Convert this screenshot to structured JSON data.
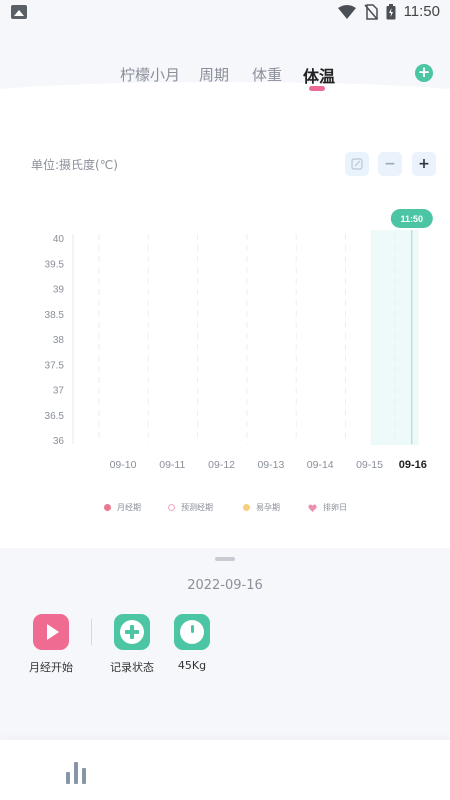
{
  "status_bar": {
    "time": "11:50"
  },
  "tabs": [
    {
      "label": "柠檬小月",
      "active": false
    },
    {
      "label": "周期",
      "active": false
    },
    {
      "label": "体重",
      "active": false
    },
    {
      "label": "体温",
      "active": true
    }
  ],
  "add_button": "+",
  "unit_label": "单位:摄氏度(℃)",
  "controls": {
    "minus": "−",
    "plus": "+"
  },
  "chart_data": {
    "type": "line",
    "title": "",
    "ylabel": "",
    "xlabel": "",
    "ylim": [
      36,
      40
    ],
    "yticks": [
      "40",
      "39.5",
      "39",
      "38.5",
      "38",
      "37.5",
      "37",
      "36.5",
      "36"
    ],
    "categories": [
      "09-10",
      "09-11",
      "09-12",
      "09-13",
      "09-14",
      "09-15",
      "09-16"
    ],
    "selected": "09-16",
    "marker_label": "11:50",
    "series": [],
    "grid": true
  },
  "legend": [
    {
      "label": "月经期",
      "color": "#e8798f"
    },
    {
      "label": "预测经期",
      "color": "#f4a9bf"
    },
    {
      "label": "易孕期",
      "color": "#f6cf7a"
    },
    {
      "label": "排卵日",
      "color": "#ef8fb0"
    }
  ],
  "selected_date": "2022-09-16",
  "actions": [
    {
      "label": "月经开始",
      "icon": "play-icon",
      "color": "#f06b92"
    },
    {
      "label": "记录状态",
      "icon": "plus-circle-icon",
      "color": "#4bc5a3"
    },
    {
      "label": "45Kg",
      "icon": "scale-icon",
      "color": "#4bc5a3"
    }
  ],
  "bottom_nav": {
    "icon": "bar-chart-icon"
  }
}
